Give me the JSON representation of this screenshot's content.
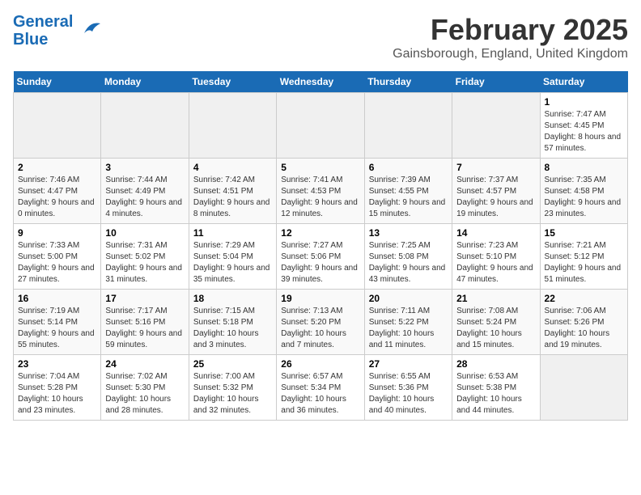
{
  "header": {
    "logo_general": "General",
    "logo_blue": "Blue",
    "month_title": "February 2025",
    "location": "Gainsborough, England, United Kingdom"
  },
  "days_of_week": [
    "Sunday",
    "Monday",
    "Tuesday",
    "Wednesday",
    "Thursday",
    "Friday",
    "Saturday"
  ],
  "weeks": [
    [
      {
        "day": "",
        "info": ""
      },
      {
        "day": "",
        "info": ""
      },
      {
        "day": "",
        "info": ""
      },
      {
        "day": "",
        "info": ""
      },
      {
        "day": "",
        "info": ""
      },
      {
        "day": "",
        "info": ""
      },
      {
        "day": "1",
        "info": "Sunrise: 7:47 AM\nSunset: 4:45 PM\nDaylight: 8 hours and 57 minutes."
      }
    ],
    [
      {
        "day": "2",
        "info": "Sunrise: 7:46 AM\nSunset: 4:47 PM\nDaylight: 9 hours and 0 minutes."
      },
      {
        "day": "3",
        "info": "Sunrise: 7:44 AM\nSunset: 4:49 PM\nDaylight: 9 hours and 4 minutes."
      },
      {
        "day": "4",
        "info": "Sunrise: 7:42 AM\nSunset: 4:51 PM\nDaylight: 9 hours and 8 minutes."
      },
      {
        "day": "5",
        "info": "Sunrise: 7:41 AM\nSunset: 4:53 PM\nDaylight: 9 hours and 12 minutes."
      },
      {
        "day": "6",
        "info": "Sunrise: 7:39 AM\nSunset: 4:55 PM\nDaylight: 9 hours and 15 minutes."
      },
      {
        "day": "7",
        "info": "Sunrise: 7:37 AM\nSunset: 4:57 PM\nDaylight: 9 hours and 19 minutes."
      },
      {
        "day": "8",
        "info": "Sunrise: 7:35 AM\nSunset: 4:58 PM\nDaylight: 9 hours and 23 minutes."
      }
    ],
    [
      {
        "day": "9",
        "info": "Sunrise: 7:33 AM\nSunset: 5:00 PM\nDaylight: 9 hours and 27 minutes."
      },
      {
        "day": "10",
        "info": "Sunrise: 7:31 AM\nSunset: 5:02 PM\nDaylight: 9 hours and 31 minutes."
      },
      {
        "day": "11",
        "info": "Sunrise: 7:29 AM\nSunset: 5:04 PM\nDaylight: 9 hours and 35 minutes."
      },
      {
        "day": "12",
        "info": "Sunrise: 7:27 AM\nSunset: 5:06 PM\nDaylight: 9 hours and 39 minutes."
      },
      {
        "day": "13",
        "info": "Sunrise: 7:25 AM\nSunset: 5:08 PM\nDaylight: 9 hours and 43 minutes."
      },
      {
        "day": "14",
        "info": "Sunrise: 7:23 AM\nSunset: 5:10 PM\nDaylight: 9 hours and 47 minutes."
      },
      {
        "day": "15",
        "info": "Sunrise: 7:21 AM\nSunset: 5:12 PM\nDaylight: 9 hours and 51 minutes."
      }
    ],
    [
      {
        "day": "16",
        "info": "Sunrise: 7:19 AM\nSunset: 5:14 PM\nDaylight: 9 hours and 55 minutes."
      },
      {
        "day": "17",
        "info": "Sunrise: 7:17 AM\nSunset: 5:16 PM\nDaylight: 9 hours and 59 minutes."
      },
      {
        "day": "18",
        "info": "Sunrise: 7:15 AM\nSunset: 5:18 PM\nDaylight: 10 hours and 3 minutes."
      },
      {
        "day": "19",
        "info": "Sunrise: 7:13 AM\nSunset: 5:20 PM\nDaylight: 10 hours and 7 minutes."
      },
      {
        "day": "20",
        "info": "Sunrise: 7:11 AM\nSunset: 5:22 PM\nDaylight: 10 hours and 11 minutes."
      },
      {
        "day": "21",
        "info": "Sunrise: 7:08 AM\nSunset: 5:24 PM\nDaylight: 10 hours and 15 minutes."
      },
      {
        "day": "22",
        "info": "Sunrise: 7:06 AM\nSunset: 5:26 PM\nDaylight: 10 hours and 19 minutes."
      }
    ],
    [
      {
        "day": "23",
        "info": "Sunrise: 7:04 AM\nSunset: 5:28 PM\nDaylight: 10 hours and 23 minutes."
      },
      {
        "day": "24",
        "info": "Sunrise: 7:02 AM\nSunset: 5:30 PM\nDaylight: 10 hours and 28 minutes."
      },
      {
        "day": "25",
        "info": "Sunrise: 7:00 AM\nSunset: 5:32 PM\nDaylight: 10 hours and 32 minutes."
      },
      {
        "day": "26",
        "info": "Sunrise: 6:57 AM\nSunset: 5:34 PM\nDaylight: 10 hours and 36 minutes."
      },
      {
        "day": "27",
        "info": "Sunrise: 6:55 AM\nSunset: 5:36 PM\nDaylight: 10 hours and 40 minutes."
      },
      {
        "day": "28",
        "info": "Sunrise: 6:53 AM\nSunset: 5:38 PM\nDaylight: 10 hours and 44 minutes."
      },
      {
        "day": "",
        "info": ""
      }
    ]
  ]
}
